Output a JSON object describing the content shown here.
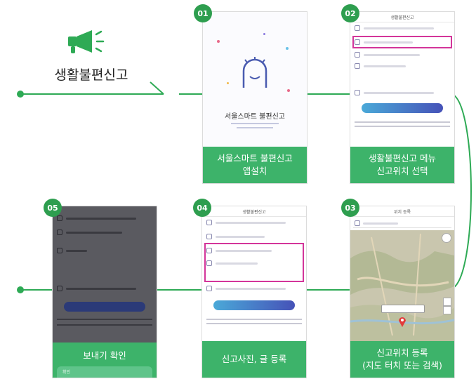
{
  "header": {
    "title": "생활불편신고"
  },
  "steps": [
    {
      "number": "01",
      "caption_line1": "서울스마트 불편신고",
      "caption_line2": "앱설치",
      "screen": {
        "app_name": "서울스마트 불편신고"
      }
    },
    {
      "number": "02",
      "caption_line1": "생활불편신고 메뉴",
      "caption_line2": "신고위치 선택",
      "screen": {
        "title": "생활불편신고"
      }
    },
    {
      "number": "03",
      "caption_line1": "신고위치 등록",
      "caption_line2": "(지도 터치 또는 검색)",
      "screen": {
        "title": "위치 등록"
      }
    },
    {
      "number": "04",
      "caption_line1": "신고사진, 글 등록",
      "caption_line2": "",
      "screen": {
        "title": "생활불편신고"
      }
    },
    {
      "number": "05",
      "caption_line1": "보내기 확인",
      "caption_line2": "",
      "screen": {
        "confirm_label": "확인"
      }
    }
  ],
  "colors": {
    "green": "#3db36a",
    "dark_green": "#2e9e4f",
    "highlight": "#d3359a"
  }
}
